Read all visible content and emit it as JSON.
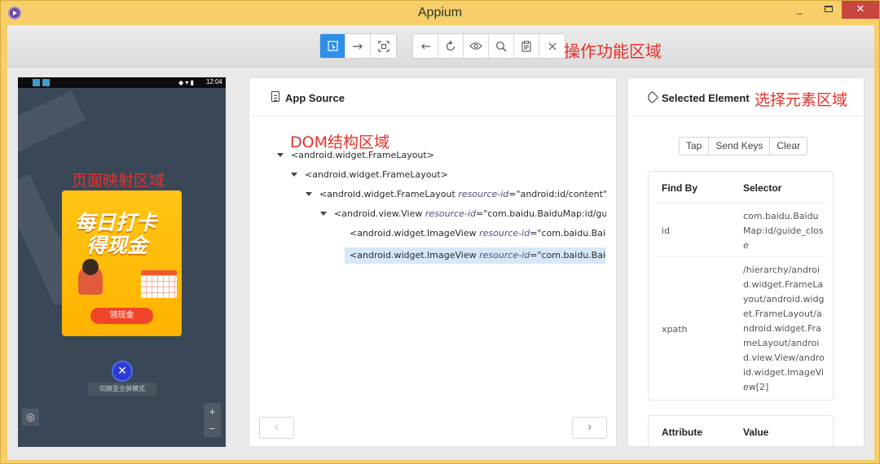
{
  "window": {
    "title": "Appium",
    "minimize": "_",
    "close": "✕"
  },
  "toolbar": {
    "annotation": "操作功能区域",
    "left_group": [
      "select-icon",
      "swipe-icon",
      "tap-coordinates-icon"
    ],
    "right_group": [
      "back-icon",
      "refresh-icon",
      "eye-icon",
      "search-icon",
      "clipboard-icon",
      "close-icon"
    ]
  },
  "device": {
    "time": "12:04",
    "annotation": "页面映射区域",
    "promo_title_line1": "每日打卡",
    "promo_title_line2": "得现金",
    "promo_button": "领现金",
    "close": "✕",
    "switch_label": "切换至全屏模式",
    "zoom_in": "+",
    "zoom_out": "−"
  },
  "source": {
    "title": "App Source",
    "annotation": "DOM结构区域",
    "rows": [
      {
        "tag": "<android.widget.FrameLayout>",
        "attr": "",
        "val": ""
      },
      {
        "tag": "<android.widget.FrameLayout>",
        "attr": "",
        "val": ""
      },
      {
        "tag": "<android.widget.FrameLayout ",
        "attr": "resource-id",
        "val": "=\"android:id/content\">"
      },
      {
        "tag": "<android.view.View ",
        "attr": "resource-id",
        "val": "=\"com.baidu.BaiduMap:id/guide"
      },
      {
        "tag": "<android.widget.ImageView ",
        "attr": "resource-id",
        "val": "=\"com.baidu.BaiduM"
      },
      {
        "tag": "<android.widget.ImageView ",
        "attr": "resource-id",
        "val": "=\"com.baidu.BaiduM"
      }
    ],
    "prev": "‹",
    "next": "›"
  },
  "selected": {
    "title": "Selected Element",
    "annotation": "选择元素区域",
    "actions": [
      "Tap",
      "Send Keys",
      "Clear"
    ],
    "find_headers": [
      "Find By",
      "Selector"
    ],
    "find_rows": [
      {
        "by": "id",
        "selector": "com.baidu.BaiduMap:id/guide_close"
      },
      {
        "by": "xpath",
        "selector": "/hierarchy/android.widget.FrameLayout/android.widget.FrameLayout/android.widget.FrameLayout/android.view.View/android.widget.ImageView[2]"
      }
    ],
    "attr_headers": [
      "Attribute",
      "Value"
    ]
  },
  "colors": {
    "accent": "#2d8fe8",
    "annotation": "#e8302a",
    "titlebar": "#f6cf6a",
    "selection": "#d6e8f8"
  }
}
